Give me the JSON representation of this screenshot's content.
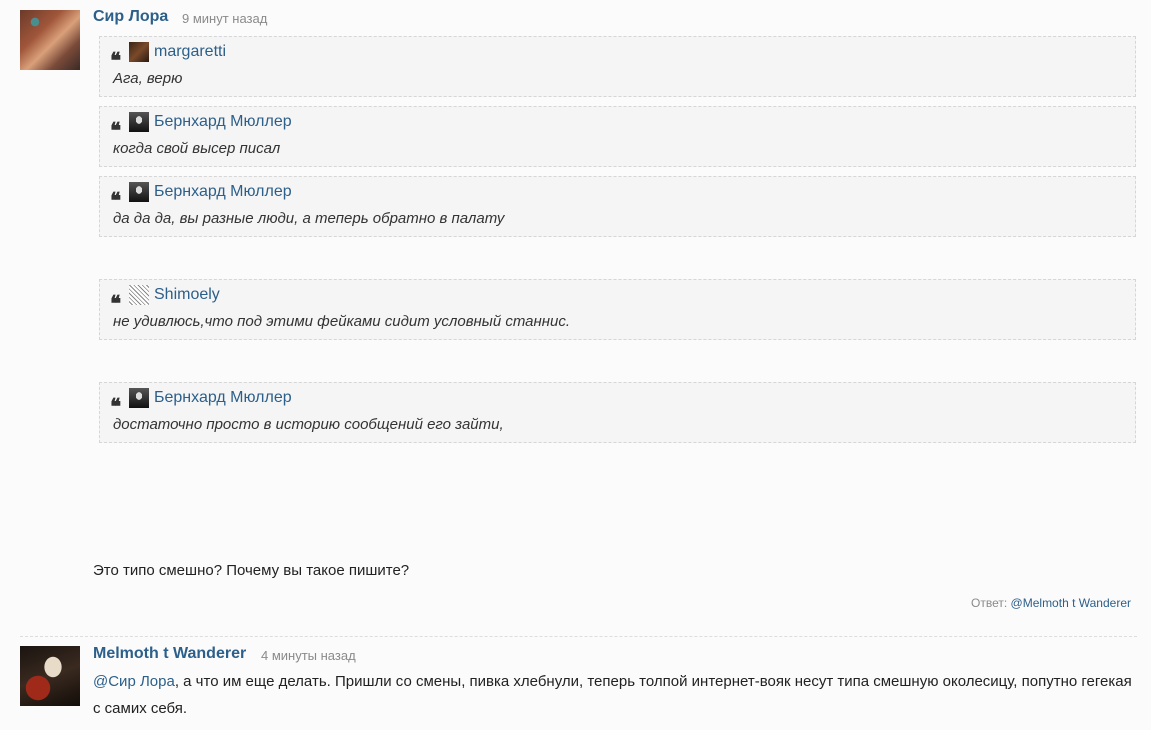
{
  "comment1": {
    "author": "Сир Лора",
    "time": "9 минут назад",
    "quotes": [
      {
        "user": "margaretti",
        "text": "Ага, верю"
      },
      {
        "user": "Бернхард Мюллер",
        "text": "когда свой высер писал"
      },
      {
        "user": "Бернхард Мюллер",
        "text": "да да да, вы разные люди, а теперь обратно в палату"
      },
      {
        "user": "Shimoely",
        "text": "не удивлюсь,что под этими фейками сидит условный станнис."
      },
      {
        "user": "Бернхард Мюллер",
        "text": "достаточно просто в историю сообщений его зайти,"
      }
    ],
    "body": "Это типо смешно? Почему вы такое пишите?",
    "reply_label": "Ответ:",
    "reply_to": "@Melmoth t Wanderer"
  },
  "comment2": {
    "author": "Melmoth t Wanderer",
    "time": "4 минуты назад",
    "mention": "@Сир Лора",
    "body": ", а что им еще делать. Пришли со смены, пивка хлебнули, теперь толпой интернет-вояк несут типа смешную околесицу, попутно гегекая с самих себя."
  }
}
